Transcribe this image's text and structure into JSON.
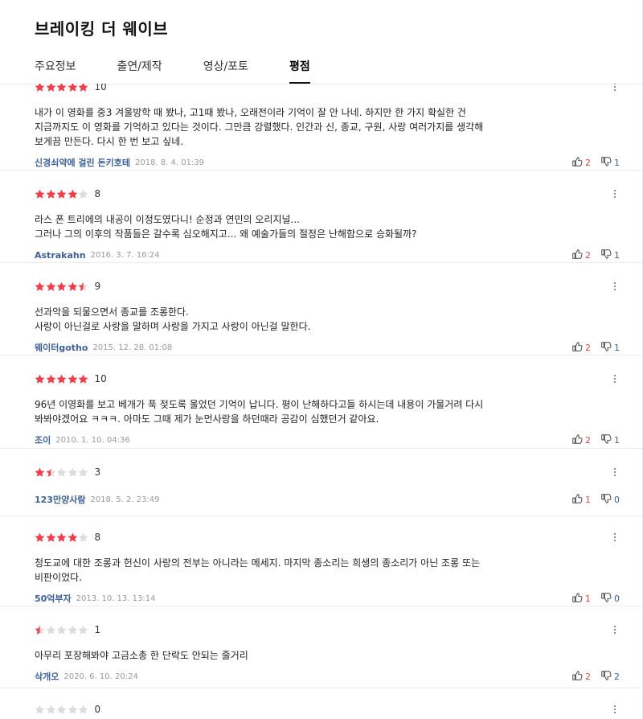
{
  "page": {
    "title": "브레이킹 더 웨이브"
  },
  "tabs": [
    {
      "label": "주요정보",
      "active": false
    },
    {
      "label": "출연/제작",
      "active": false
    },
    {
      "label": "영상/포토",
      "active": false
    },
    {
      "label": "평점",
      "active": true
    }
  ],
  "colors": {
    "star_on": "#ef3f4b",
    "star_off": "#dcdcdc",
    "nickname": "#3d6196",
    "like": "#e14848",
    "dislike": "#3d6196"
  },
  "reviews": [
    {
      "rating": 5,
      "score": "10",
      "text": "내가 이 영화를 중3 겨울방학 때 봤나, 고1때 봤나, 오래전이라 기억이 잘 안 나네. 하지만 한 가지 확실한 건\n지금까지도 이 영화를 기억하고 있다는 것이다. 그만큼 강렬했다. 인간과 신, 종교, 구원, 사랑 여러가지를 생각해\n보게끔 만든다. 다시 한 번 보고 싶네.",
      "nickname": "신경쇠약에 걸린 돈키호테",
      "date": "2018. 8. 4. 01:39",
      "likes": "2",
      "dislikes": "1"
    },
    {
      "rating": 4,
      "score": "8",
      "text": "라스 폰 트리에의 내공이 이정도였다니! 순정과 연민의 오리지널...\n그러나 그의 이후의 작품들은 갈수록 심오해지고... 왜 예술가들의 절정은 난해함으로 승화될까?",
      "nickname": "Astrakahn",
      "date": "2016. 3. 7. 16:24",
      "likes": "2",
      "dislikes": "1"
    },
    {
      "rating": 4.5,
      "score": "9",
      "text": "선과악을 되물으면서 종교를 조롱한다.\n사랑이 아닌걸로 사랑을 말하며 사랑을 가지고 사랑이 아닌걸 말한다.",
      "nickname": "웨이터gotho",
      "date": "2015. 12. 28. 01:08",
      "likes": "2",
      "dislikes": "1"
    },
    {
      "rating": 5,
      "score": "10",
      "text": "96년 이영화를 보고 베개가 푹 젖도록 울었던 기억이 납니다. 평이 난해하다고들 하시는데 내용이 가물거려 다시\n봐봐야겠어요 ㅋㅋㅋ. 아마도 그때 제가 눈먼사랑을 하던때라 공감이 심했던거 같아요.",
      "nickname": "조이",
      "date": "2010. 1. 10. 04:36",
      "likes": "2",
      "dislikes": "1"
    },
    {
      "rating": 1.5,
      "score": "3",
      "text": "",
      "nickname": "123만양사람",
      "date": "2018. 5. 2. 23:49",
      "likes": "1",
      "dislikes": "0"
    },
    {
      "rating": 4,
      "score": "8",
      "text": "청도교에 대한 조롱과 헌신이 사랑의 전부는 아니라는 메세지. 마지막 종소리는 희생의 종소리가 아닌 조롱 또는\n비판이었다.",
      "nickname": "50억부자",
      "date": "2013. 10. 13. 13:14",
      "likes": "1",
      "dislikes": "0"
    },
    {
      "rating": 0.5,
      "score": "1",
      "text": "아무리 포장해봐야 고금소총 한 단락도 안되는 줄거리",
      "nickname": "삭개오",
      "date": "2020. 6. 10. 20:24",
      "likes": "2",
      "dislikes": "2"
    },
    {
      "rating": 0,
      "score": "0",
      "text": "",
      "nickname": "",
      "date": "",
      "likes": "",
      "dislikes": ""
    }
  ]
}
